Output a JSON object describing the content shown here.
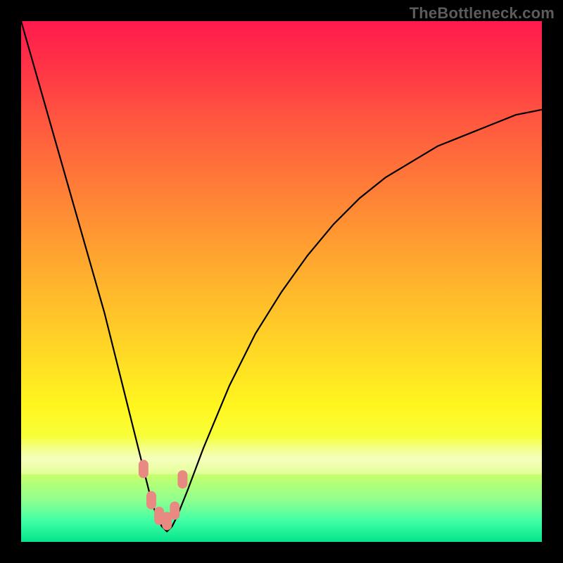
{
  "watermark": "TheBottleneck.com",
  "chart_data": {
    "type": "line",
    "title": "",
    "xlabel": "",
    "ylabel": "",
    "xlim": [
      0,
      100
    ],
    "ylim": [
      0,
      100
    ],
    "grid": false,
    "series": [
      {
        "name": "bottleneck-curve",
        "x": [
          0,
          4,
          8,
          12,
          16,
          18,
          20,
          22,
          24,
          25,
          26,
          27,
          28,
          29,
          30,
          32,
          35,
          40,
          45,
          50,
          55,
          60,
          65,
          70,
          75,
          80,
          85,
          90,
          95,
          100
        ],
        "y": [
          100,
          86,
          72,
          58,
          44,
          36,
          28,
          20,
          12,
          8,
          5,
          3,
          2,
          3,
          5,
          10,
          18,
          30,
          40,
          48,
          55,
          61,
          66,
          70,
          73,
          76,
          78,
          80,
          82,
          83
        ]
      }
    ],
    "markers": [
      {
        "x": 23.5,
        "y": 14,
        "color": "#e88a82"
      },
      {
        "x": 25.0,
        "y": 8,
        "color": "#e88a82"
      },
      {
        "x": 26.5,
        "y": 5,
        "color": "#e88a82"
      },
      {
        "x": 28.0,
        "y": 4,
        "color": "#e88a82"
      },
      {
        "x": 29.5,
        "y": 6,
        "color": "#e88a82"
      },
      {
        "x": 31.0,
        "y": 12,
        "color": "#e88a82"
      }
    ],
    "gradient_stops": [
      {
        "pos": 0.0,
        "color": "#ff1a4d"
      },
      {
        "pos": 0.2,
        "color": "#ff5a3f"
      },
      {
        "pos": 0.48,
        "color": "#ffad2e"
      },
      {
        "pos": 0.74,
        "color": "#fff61f"
      },
      {
        "pos": 0.92,
        "color": "#8fff8f"
      },
      {
        "pos": 1.0,
        "color": "#05e38b"
      }
    ]
  }
}
